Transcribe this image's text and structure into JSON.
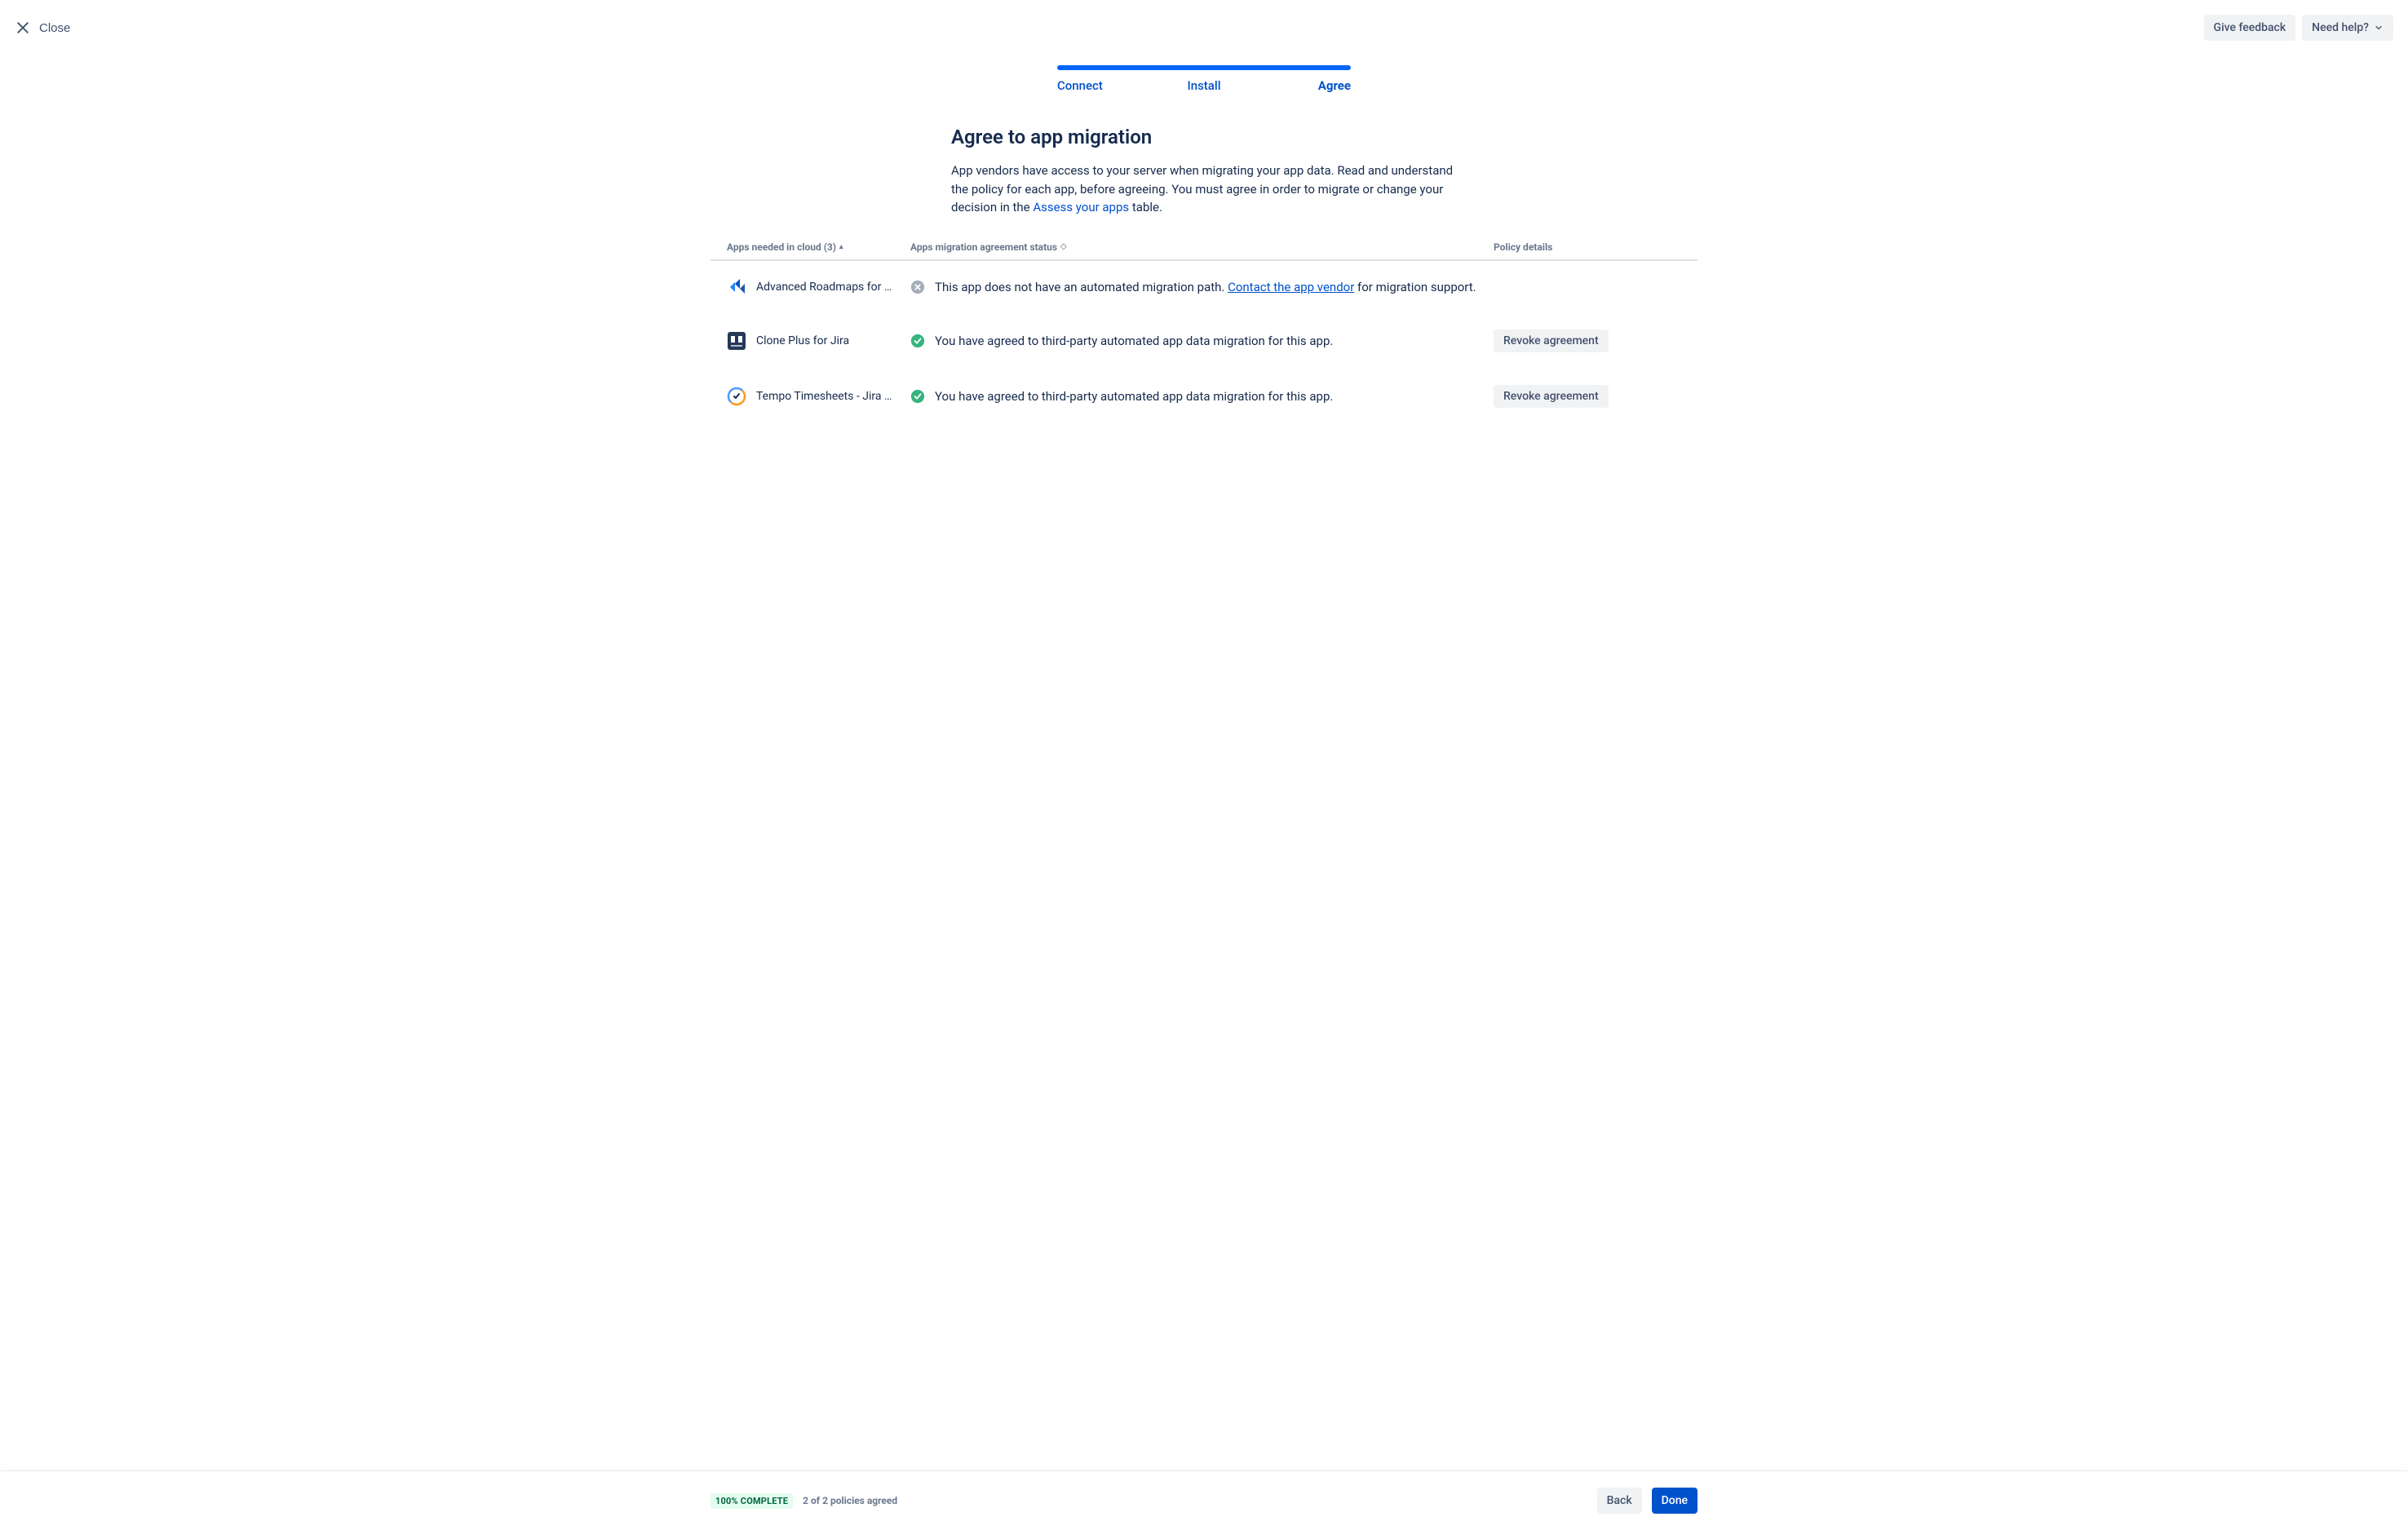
{
  "topbar": {
    "close_label": "Close",
    "feedback_label": "Give feedback",
    "help_label": "Need help?"
  },
  "stepper": {
    "steps": [
      "Connect",
      "Install",
      "Agree"
    ],
    "active_index": 2
  },
  "heading": "Agree to app migration",
  "description_parts": {
    "p1": "App vendors have access to your server when migrating your app data. Read and understand the policy for each app, before agreeing. You must agree in order to migrate or change your decision in the ",
    "link": "Assess your apps",
    "p2": " table."
  },
  "columns": {
    "apps": "Apps needed in cloud (3)",
    "status": "Apps migration agreement status",
    "policy": "Policy details"
  },
  "rows": [
    {
      "name": "Advanced Roadmaps for …",
      "icon": "roadmaps",
      "status_type": "none",
      "status_text_pre": "This app does not have an automated migration path. ",
      "status_link": "Contact the app vendor",
      "status_text_post": " for migration support.",
      "action": null
    },
    {
      "name": "Clone Plus for Jira",
      "icon": "cloneplus",
      "status_type": "agreed",
      "status_text": "You have agreed to third-party automated app data migration for this app.",
      "action": "Revoke agreement"
    },
    {
      "name": "Tempo Timesheets - Jira …",
      "icon": "tempo",
      "status_type": "agreed",
      "status_text": "You have agreed to third-party automated app data migration for this app.",
      "action": "Revoke agreement"
    }
  ],
  "footer": {
    "complete_badge": "100% COMPLETE",
    "subtext": "2 of 2 policies agreed",
    "back_label": "Back",
    "done_label": "Done"
  }
}
